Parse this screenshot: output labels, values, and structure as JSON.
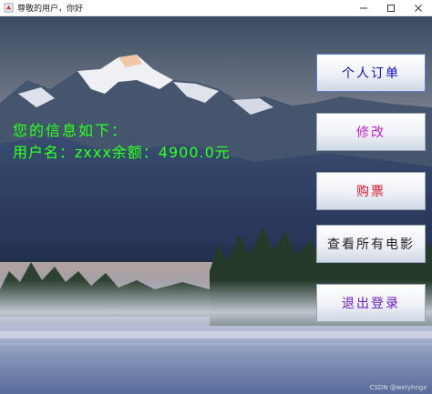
{
  "window": {
    "title": "尊敬的用户，你好",
    "controls": {
      "minimize_icon": "minimize-icon",
      "maximize_icon": "maximize-icon",
      "close_icon": "close-icon"
    }
  },
  "info": {
    "line1": "您的信息如下：",
    "line2": "用户名：zxxx余额：4900.0元"
  },
  "menu": {
    "my_orders": "个人订单",
    "modify": "修改",
    "buy_ticket": "购票",
    "view_movies": "查看所有电影",
    "logout": "退出登录"
  },
  "watermark": "CSDN @weiyhngz",
  "colors": {
    "info_text": "#33ff33",
    "my_orders": "#1010c8",
    "modify": "#c020c8",
    "buy_ticket": "#e0102a",
    "view_movies": "#222222",
    "logout": "#6a18c8"
  }
}
